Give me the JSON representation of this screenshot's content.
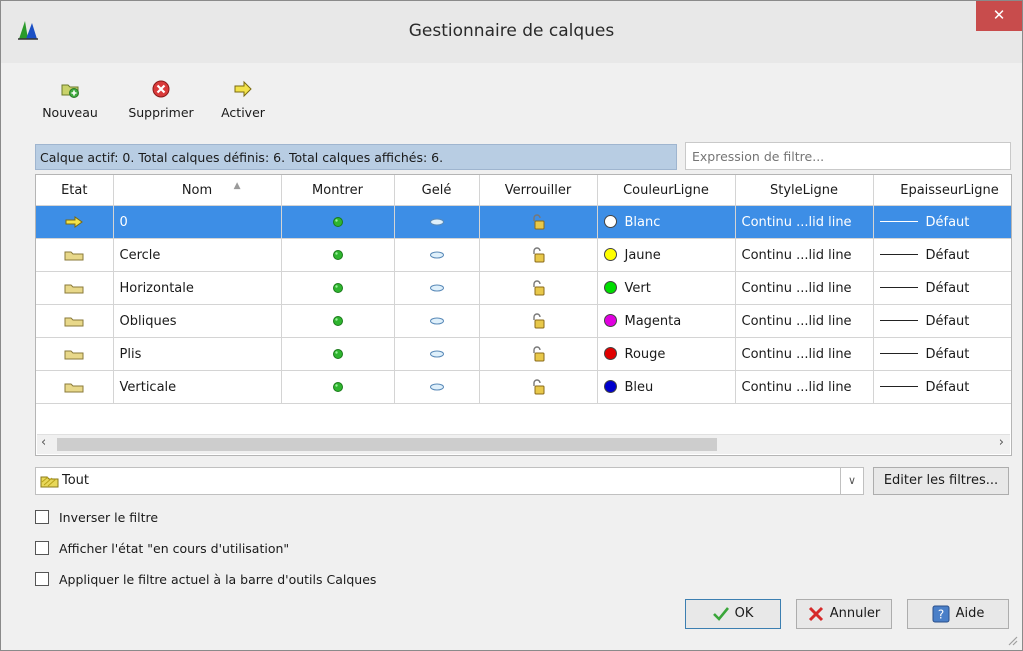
{
  "window": {
    "title": "Gestionnaire de calques",
    "close_glyph": "✕"
  },
  "toolbar": {
    "new_label": "Nouveau",
    "delete_label": "Supprimer",
    "activate_label": "Activer"
  },
  "status": {
    "text": "Calque actif: 0. Total calques définis: 6. Total calques affichés: 6."
  },
  "filter_expression": {
    "placeholder": "Expression de filtre..."
  },
  "table": {
    "columns": [
      "Etat",
      "Nom",
      "Montrer",
      "Gelé",
      "Verrouiller",
      "CouleurLigne",
      "StyleLigne",
      "EpaisseurLigne"
    ],
    "rows": [
      {
        "state": "active",
        "name": "0",
        "color_name": "Blanc",
        "color_hex": "#ffffff",
        "linestyle": "Continu ...lid line",
        "lineweight": "Défaut",
        "selected": true
      },
      {
        "state": "layer",
        "name": "Cercle",
        "color_name": "Jaune",
        "color_hex": "#ffff00",
        "linestyle": "Continu ...lid line",
        "lineweight": "Défaut",
        "selected": false
      },
      {
        "state": "layer",
        "name": "Horizontale",
        "color_name": "Vert",
        "color_hex": "#00dd00",
        "linestyle": "Continu ...lid line",
        "lineweight": "Défaut",
        "selected": false
      },
      {
        "state": "layer",
        "name": "Obliques",
        "color_name": "Magenta",
        "color_hex": "#e000e0",
        "linestyle": "Continu ...lid line",
        "lineweight": "Défaut",
        "selected": false
      },
      {
        "state": "layer",
        "name": "Plis",
        "color_name": "Rouge",
        "color_hex": "#e00000",
        "linestyle": "Continu ...lid line",
        "lineweight": "Défaut",
        "selected": false
      },
      {
        "state": "layer",
        "name": "Verticale",
        "color_name": "Bleu",
        "color_hex": "#0000cc",
        "linestyle": "Continu ...lid line",
        "lineweight": "Défaut",
        "selected": false
      }
    ]
  },
  "filter_select": {
    "value": "Tout",
    "edit_label": "Editer les filtres..."
  },
  "options": {
    "invert": "Inverser le filtre",
    "in_use": "Afficher l'état \"en cours d'utilisation\"",
    "apply_toolbar": "Appliquer le filtre actuel à la barre d'outils Calques"
  },
  "buttons": {
    "ok": "OK",
    "cancel": "Annuler",
    "help": "Aide"
  },
  "colors": {
    "selection": "#3d8ee6",
    "status_bg": "#b8cde3",
    "close_bg": "#c84c4c"
  }
}
